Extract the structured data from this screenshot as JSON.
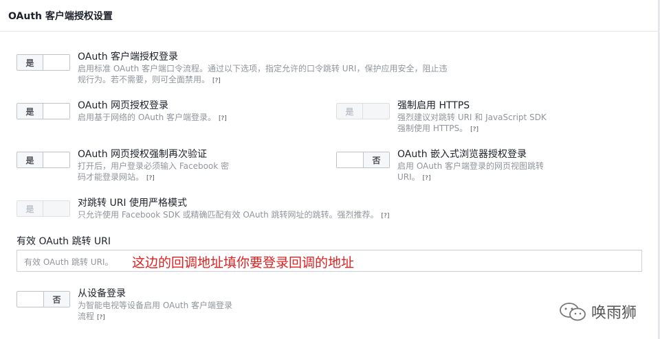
{
  "panel": {
    "title": "OAuth 客户端授权设置"
  },
  "settings": {
    "client_oauth": {
      "toggle": "是",
      "title": "OAuth 客户端授权登录",
      "desc_line1": "启用标准 OAuth 客户端口令流程。通过以下选项，指定允许的口令跳转 URI，保护应用安全，阻止违",
      "desc_line2": "规行为。若不需要，则可全面禁用。",
      "help": "[?]"
    },
    "web_oauth": {
      "toggle": "是",
      "title": "OAuth 网页授权登录",
      "desc": "启用基于网络的 OAuth 客户端登录。",
      "help": "[?]"
    },
    "force_https": {
      "toggle": "是",
      "title": "强制启用 HTTPS",
      "desc_line1": "强烈建议对跳转 URI 和 JavaScript SDK",
      "desc_line2": "强制使用 HTTPS。",
      "help": "[?]"
    },
    "web_reauth": {
      "toggle": "是",
      "title": "OAuth 网页授权强制再次验证",
      "desc_line1": "打开后，用户登录必须输入 Facebook 密",
      "desc_line2": "码才能登录网站。",
      "help": "[?]"
    },
    "embedded_browser": {
      "toggle": "否",
      "title": "OAuth 嵌入式浏览器授权登录",
      "desc_line1": "启用 OAuth 客户端登录的网页视图跳转",
      "desc_line2": "URI。",
      "help": "[?]"
    },
    "strict_mode": {
      "toggle": "是",
      "title": "对跳转 URI 使用严格模式",
      "desc": "只允许使用 Facebook SDK 或精确匹配有效 OAuth 跳转网址的跳转。强烈推荐。",
      "help": "[?]"
    },
    "device_login": {
      "toggle": "否",
      "title": "从设备登录",
      "desc_line1": "为智能电视等设备启用 OAuth 客户端登录",
      "desc_line2": "流程",
      "help": "[?]"
    }
  },
  "redirect_uri": {
    "label": "有效 OAuth 跳转 URI",
    "placeholder": "有效 OAuth 跳转 URI。"
  },
  "annotation": "这边的回调地址填你要登录回调的地址",
  "watermark": {
    "text": "唤雨狮",
    "icon": "wechat-icon"
  },
  "colors": {
    "annotation": "#e02020",
    "border": "#bec2c9",
    "muted": "#90949c"
  }
}
